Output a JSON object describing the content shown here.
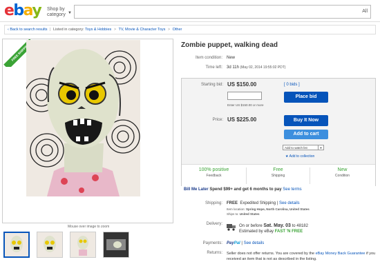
{
  "header": {
    "logo_letters": [
      "e",
      "b",
      "a",
      "y"
    ],
    "shop_by_line1": "Shop by",
    "shop_by_line2": "category",
    "search_placeholder": "",
    "search_scope": "All"
  },
  "breadcrumb": {
    "back": "Back to search results",
    "listed_in": "Listed in category:",
    "path": [
      "Toys & Hobbies",
      "TV, Movie & Character Toys",
      "Other"
    ]
  },
  "gallery": {
    "ribbon": "FREE SHIPPING",
    "zoom_hint": "Mouse over image to zoom",
    "thumbnail_count": 4
  },
  "item": {
    "title": "Zombie puppet, walking dead",
    "condition_label": "Item condition:",
    "condition": "New",
    "time_left_label": "Time left:",
    "time_left": "3d 11h",
    "time_left_date": "(May 02, 2014   19:55:02 PDT)"
  },
  "bid": {
    "starting_label": "Starting bid:",
    "starting_amount": "US $150.00",
    "bids": "[ 0 bids ]",
    "place_bid": "Place bid",
    "hint": "Enter US $150.00 or more",
    "price_label": "Price:",
    "price_amount": "US $225.00",
    "buy_now": "Buy It Now",
    "add_to_cart": "Add to cart",
    "watch_list": "Add to watch list",
    "add_collection": "Add to collection"
  },
  "stats": [
    {
      "big": "100% positive",
      "small": "Feedback"
    },
    {
      "big": "Free",
      "small": "Shipping"
    },
    {
      "big": "New",
      "small": "Condition"
    }
  ],
  "bill_me_later": {
    "brand": "Bill Me Later",
    "text": "Spend $99+ and get 6 months to pay",
    "link": "See terms"
  },
  "shipping": {
    "label": "Shipping:",
    "value": "FREE",
    "method": "Expedited Shipping",
    "details": "See details",
    "location_label": "Item location:",
    "location": "Spring Hope, North Carolina, United States",
    "ships_label": "Ships to:",
    "ships_to": "United States"
  },
  "delivery": {
    "label": "Delivery:",
    "line1": "On or before",
    "date": "Sat. May. 03",
    "to": "to 48182",
    "line2": "Estimated by eBay",
    "fast": "FAST 'N FREE"
  },
  "payments": {
    "label": "Payments:",
    "brand_a": "Pay",
    "brand_b": "Pal",
    "details": "See details"
  },
  "returns": {
    "label": "Returns:",
    "text1": "Seller does not offer returns. You are covered by the",
    "link": "eBay Money Back Guarantee",
    "text2": "if you received an item that is not as described in the listing."
  },
  "colors": {
    "link": "#0654ba",
    "button": "#0654ba",
    "green": "#3aa335"
  }
}
